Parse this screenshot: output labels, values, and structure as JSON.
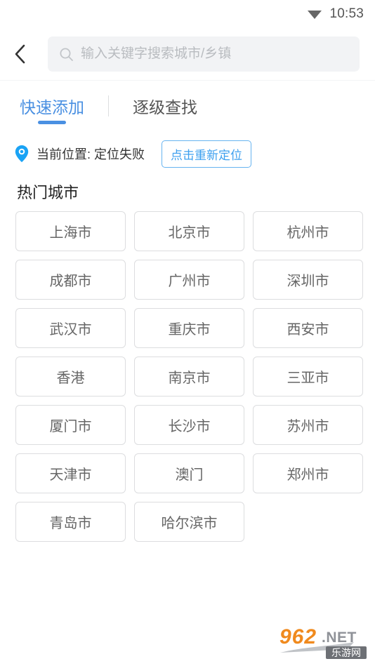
{
  "status_bar": {
    "time": "10:53",
    "wifi_icon": "wifi-icon"
  },
  "header": {
    "back_icon": "chevron-left-icon",
    "search": {
      "icon": "search-icon",
      "value": "",
      "placeholder": "输入关键字搜索城市/乡镇"
    }
  },
  "tabs": [
    {
      "label": "快速添加",
      "active": true
    },
    {
      "label": "逐级查找",
      "active": false
    }
  ],
  "location": {
    "pin_icon": "location-pin-icon",
    "label": "当前位置: 定位失败",
    "relocate_label": "点击重新定位"
  },
  "hot_cities": {
    "section_title": "热门城市",
    "items": [
      "上海市",
      "北京市",
      "杭州市",
      "成都市",
      "广州市",
      "深圳市",
      "武汉市",
      "重庆市",
      "西安市",
      "香港",
      "南京市",
      "三亚市",
      "厦门市",
      "长沙市",
      "苏州市",
      "天津市",
      "澳门",
      "郑州市",
      "青岛市",
      "哈尔滨市"
    ]
  },
  "watermark": {
    "digits": "962",
    "suffix": ".NET",
    "cn": "乐游网"
  },
  "colors": {
    "accent": "#4a90e2",
    "pin": "#1aa3f5",
    "relocate_border": "#66b3f0",
    "relocate_text": "#3ea0ef",
    "city_border": "#dcdddf",
    "city_text": "#666666",
    "search_bg": "#f2f3f5",
    "placeholder": "#b9bcc0"
  }
}
